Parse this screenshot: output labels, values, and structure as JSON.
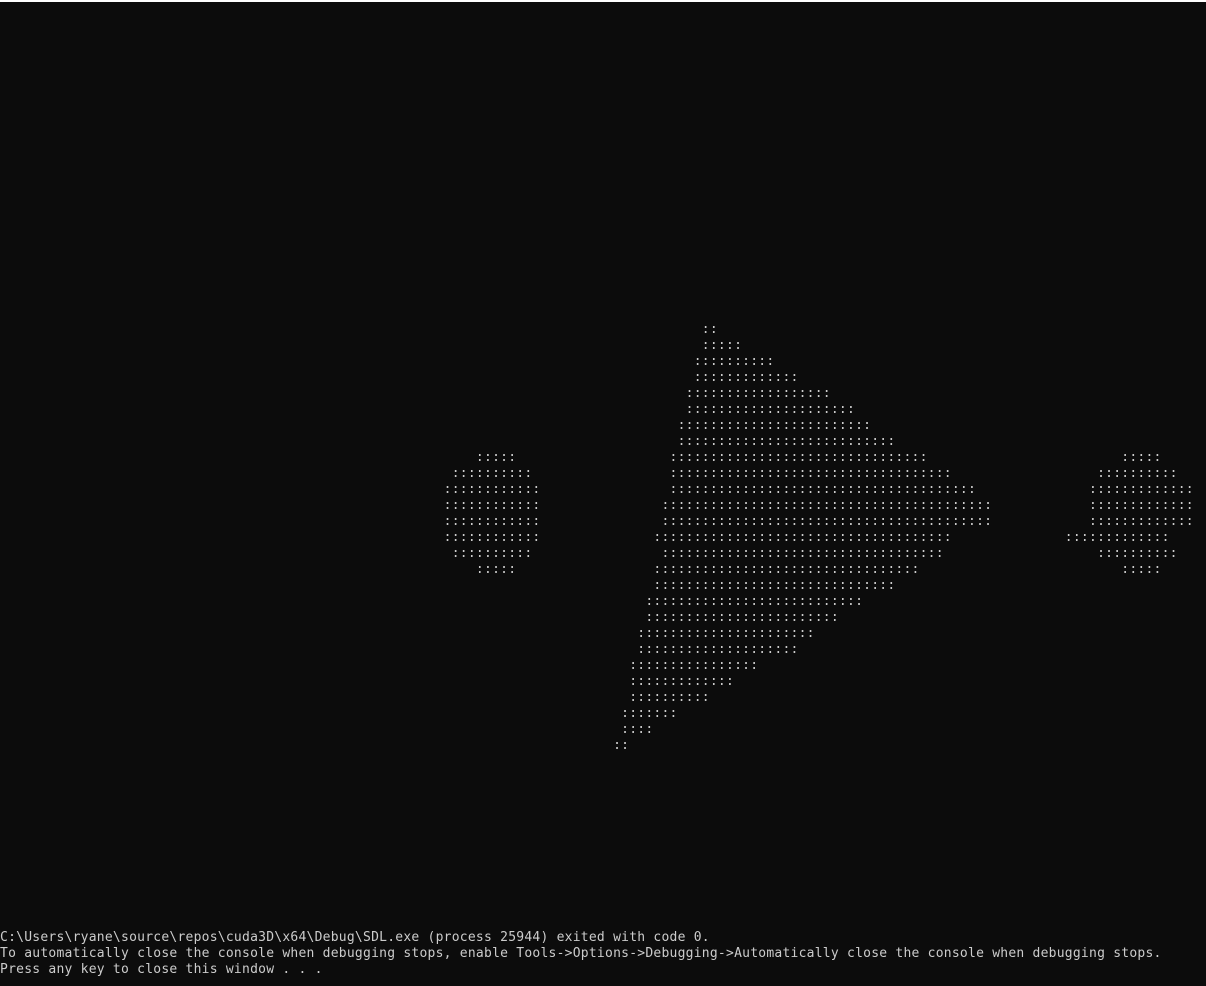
{
  "console": {
    "background_color": "#0c0c0c",
    "text_color": "#cccccc",
    "ascii_render": [
      "                                                                                       ::",
      "                                                                                       :::::",
      "                                                                                      ::::::::::",
      "                                                                                      :::::::::::::",
      "                                                                                     ::::::::::::::::::",
      "                                                                                     :::::::::::::::::::::",
      "                                                                                    ::::::::::::::::::::::::",
      "                                                                                    :::::::::::::::::::::::::::",
      "                                                           :::::                   ::::::::::::::::::::::::::::::::                        :::::",
      "                                                        ::::::::::                 :::::::::::::::::::::::::::::::::::                  ::::::::::",
      "                                                       ::::::::::::                ::::::::::::::::::::::::::::::::::::::              :::::::::::::",
      "                                                       ::::::::::::               :::::::::::::::::::::::::::::::::::::::::            :::::::::::::",
      "                                                       ::::::::::::               :::::::::::::::::::::::::::::::::::::::::            :::::::::::::",
      "                                                       ::::::::::::              :::::::::::::::::::::::::::::::::::::              :::::::::::::",
      "                                                        ::::::::::                :::::::::::::::::::::::::::::::::::                   ::::::::::",
      "                                                           :::::                 :::::::::::::::::::::::::::::::::                         :::::",
      "                                                                                 ::::::::::::::::::::::::::::::",
      "                                                                                :::::::::::::::::::::::::::",
      "                                                                                ::::::::::::::::::::::::",
      "                                                                               ::::::::::::::::::::::",
      "                                                                               ::::::::::::::::::::",
      "                                                                              ::::::::::::::::",
      "                                                                              :::::::::::::",
      "                                                                              ::::::::::",
      "                                                                             :::::::",
      "                                                                             ::::",
      "                                                                            ::"
    ],
    "messages": [
      "C:\\Users\\ryane\\source\\repos\\cuda3D\\x64\\Debug\\SDL.exe (process 25944) exited with code 0.",
      "To automatically close the console when debugging stops, enable Tools->Options->Debugging->Automatically close the console when debugging stops.",
      "Press any key to close this window . . ."
    ]
  }
}
